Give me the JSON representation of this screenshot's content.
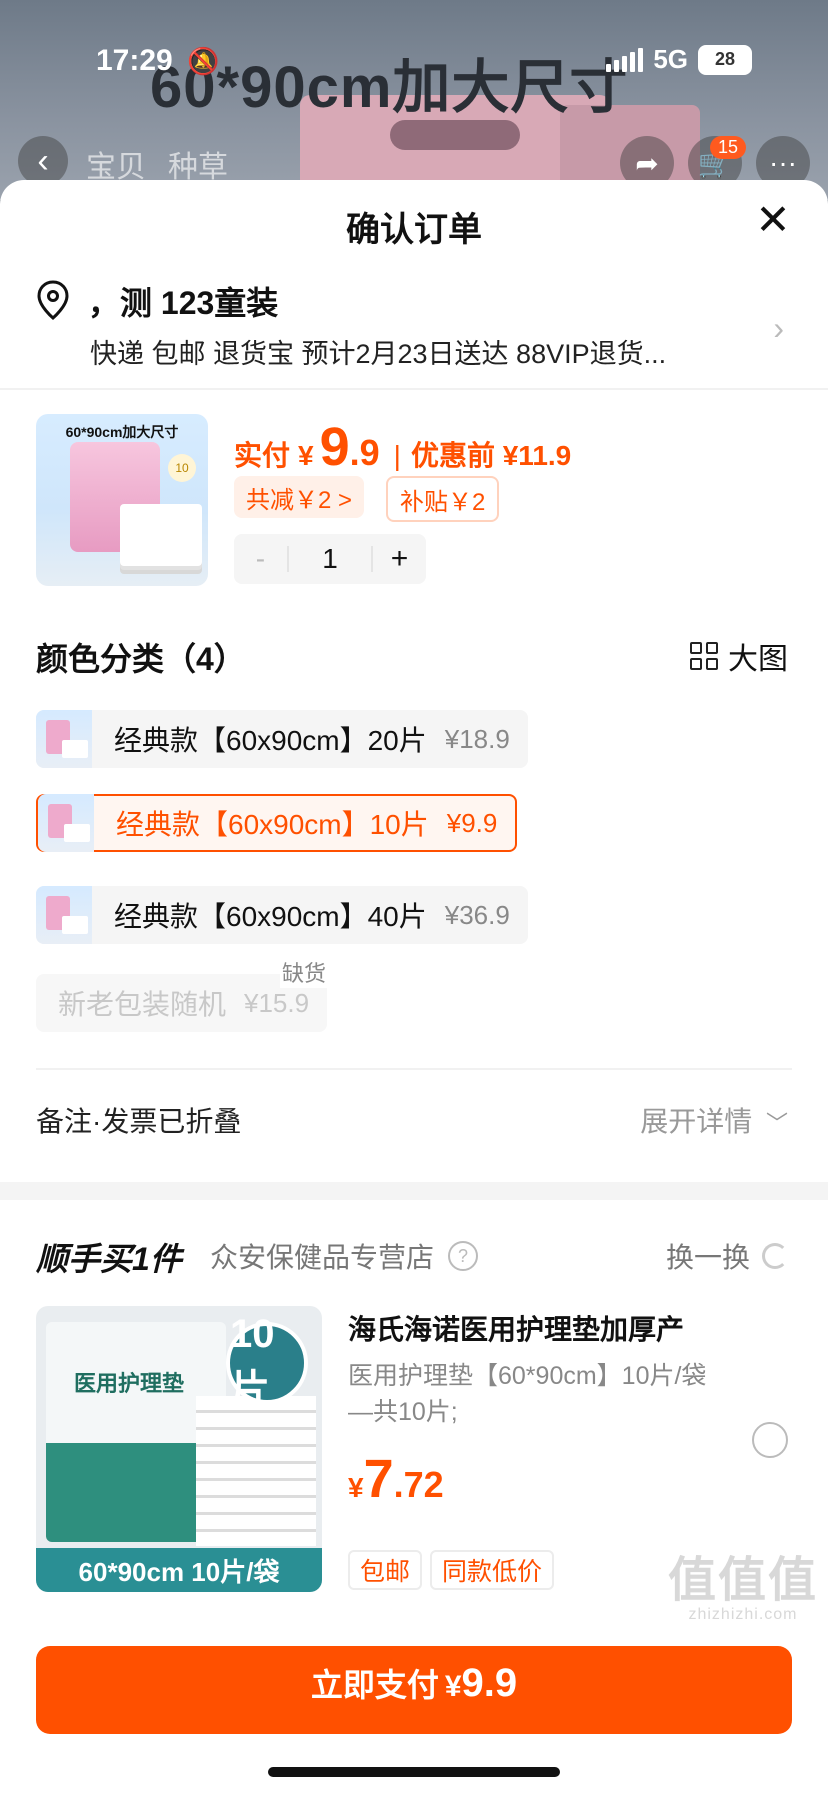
{
  "status_bar": {
    "time": "17:29",
    "network": "5G",
    "battery": "28"
  },
  "background": {
    "banner": "60*90cm加大尺寸",
    "tabs": [
      "宝贝",
      "种草"
    ],
    "cart_count": "15"
  },
  "sheet": {
    "title": "确认订单",
    "address": {
      "name": "，测 123童装",
      "info": "快递 包邮 退货宝 预计2月23日送达 88VIP退货..."
    },
    "product": {
      "image_caption": "60*90cm加大尺寸",
      "price_label": "实付",
      "price_yen": "¥",
      "price_int": "9",
      "price_dec": ".9",
      "separator": "|",
      "original_price": "优惠前 ¥11.9",
      "reduce_chip": "共减￥2 >",
      "subsidy_chip": "补贴￥2",
      "quantity": "1",
      "minus": "-",
      "plus": "+"
    },
    "variants": {
      "title": "颜色分类（4）",
      "bigpic_label": "大图",
      "options": [
        {
          "name": "经典款【60x90cm】20片",
          "price": "¥18.9",
          "state": "normal"
        },
        {
          "name": "经典款【60x90cm】10片",
          "price": "¥9.9",
          "state": "selected"
        },
        {
          "name": "经典款【60x90cm】40片",
          "price": "¥36.9",
          "state": "normal"
        },
        {
          "name": "新老包装随机",
          "price": "¥15.9",
          "state": "disabled"
        }
      ],
      "out_of_stock": "缺货"
    },
    "remark": {
      "label": "备注·发票已折叠",
      "expand": "展开详情"
    },
    "addon": {
      "title": "顺手买1件",
      "store": "众安保健品专营店",
      "swap": "换一换",
      "image_title": "医用护理垫",
      "image_badge": "10片",
      "image_strip": "60*90cm 10片/袋",
      "name": "海氏海诺医用护理垫加厚产",
      "spec": "医用护理垫【60*90cm】10片/袋—共10片;",
      "price_yen": "¥",
      "price_int": "7",
      "price_dec": ".72",
      "tags": [
        "包邮",
        "同款低价"
      ]
    },
    "pay": {
      "label": "立即支付",
      "yen": "¥",
      "amount": "9.9"
    }
  },
  "watermark": {
    "logo": "值值值",
    "domain": "zhizhizhi.com"
  },
  "colors": {
    "accent": "#ff5000",
    "accent_bg": "#fff0e8",
    "text": "#111111",
    "muted": "#888888"
  }
}
